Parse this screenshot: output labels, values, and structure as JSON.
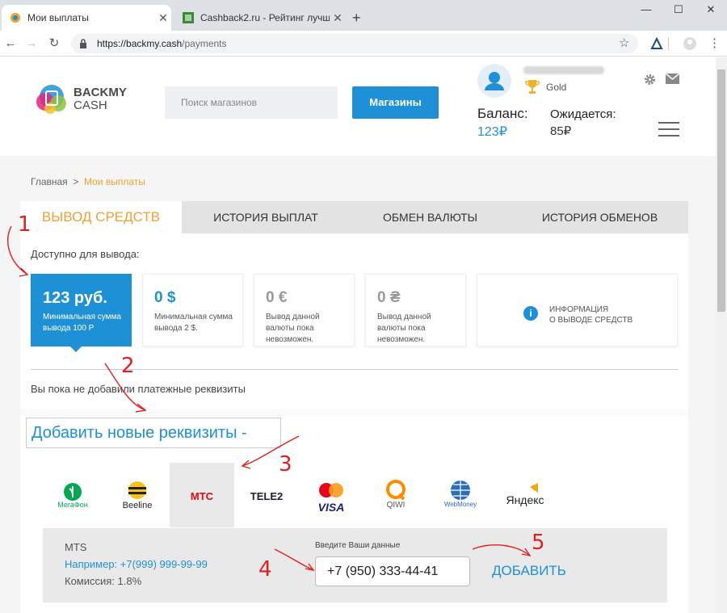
{
  "browser": {
    "tabs": [
      {
        "title": "Мои выплаты",
        "active": true
      },
      {
        "title": "Cashback2.ru - Рейтинг лучших",
        "active": false
      }
    ],
    "new_tab": "+",
    "url_host": "https://backmy.cash",
    "url_path": "/payments",
    "window_controls": [
      "—",
      "☐",
      "✕"
    ]
  },
  "header": {
    "logo_line1": "BACKMY",
    "logo_line2": "CASH",
    "search_placeholder": "Поиск магазинов",
    "shops_button": "Магазины",
    "user_level": "Gold",
    "balance_label": "Баланс:",
    "balance_value": "123₽",
    "expected_label": "Ожидается:",
    "expected_value": "85₽"
  },
  "breadcrumbs": {
    "home": "Главная",
    "sep": ">",
    "current": "Мои выплаты"
  },
  "tabs": [
    "ВЫВОД СРЕДСТВ",
    "ИСТОРИЯ ВЫПЛАТ",
    "ОБМЕН ВАЛЮТЫ",
    "ИСТОРИЯ ОБМЕНОВ"
  ],
  "available_label": "Доступно для вывода:",
  "cards": [
    {
      "amount": "123 руб.",
      "note": "Минимальная сумма вывода 100 Р"
    },
    {
      "amount": "0 $",
      "note": "Минимальная сумма вывода 2 $."
    },
    {
      "amount": "0 €",
      "note": "Вывод данной валюты пока невозможен."
    },
    {
      "amount": "0 ₴",
      "note": "Вывод данной валюты пока невозможен."
    }
  ],
  "info_card": {
    "line1": "ИНФОРМАЦИЯ",
    "line2": "О ВЫВОДЕ СРЕДСТВ"
  },
  "no_details_text": "Вы пока не добавили платежные реквизиты",
  "add_details_label": "Добавить новые реквизиты  -",
  "operators": [
    "МегаФон",
    "Beeline",
    "МТС",
    "TELE2",
    "VISA",
    "QIWI",
    "WebMoney",
    "Яндекс"
  ],
  "form": {
    "operator_name": "MTS",
    "example": "Например: +7(999) 999-99-99",
    "commission": "Комиссия: 1.8%",
    "input_label": "Введите Ваши данные",
    "input_value": "+7 (950) 333-44-41",
    "add_button": "ДОБАВИТЬ"
  },
  "annotations": [
    "1",
    "2",
    "3",
    "4",
    "5"
  ],
  "colors": {
    "accent": "#1e90d6",
    "active_tab": "#f0a030",
    "annotation": "#e02020"
  }
}
